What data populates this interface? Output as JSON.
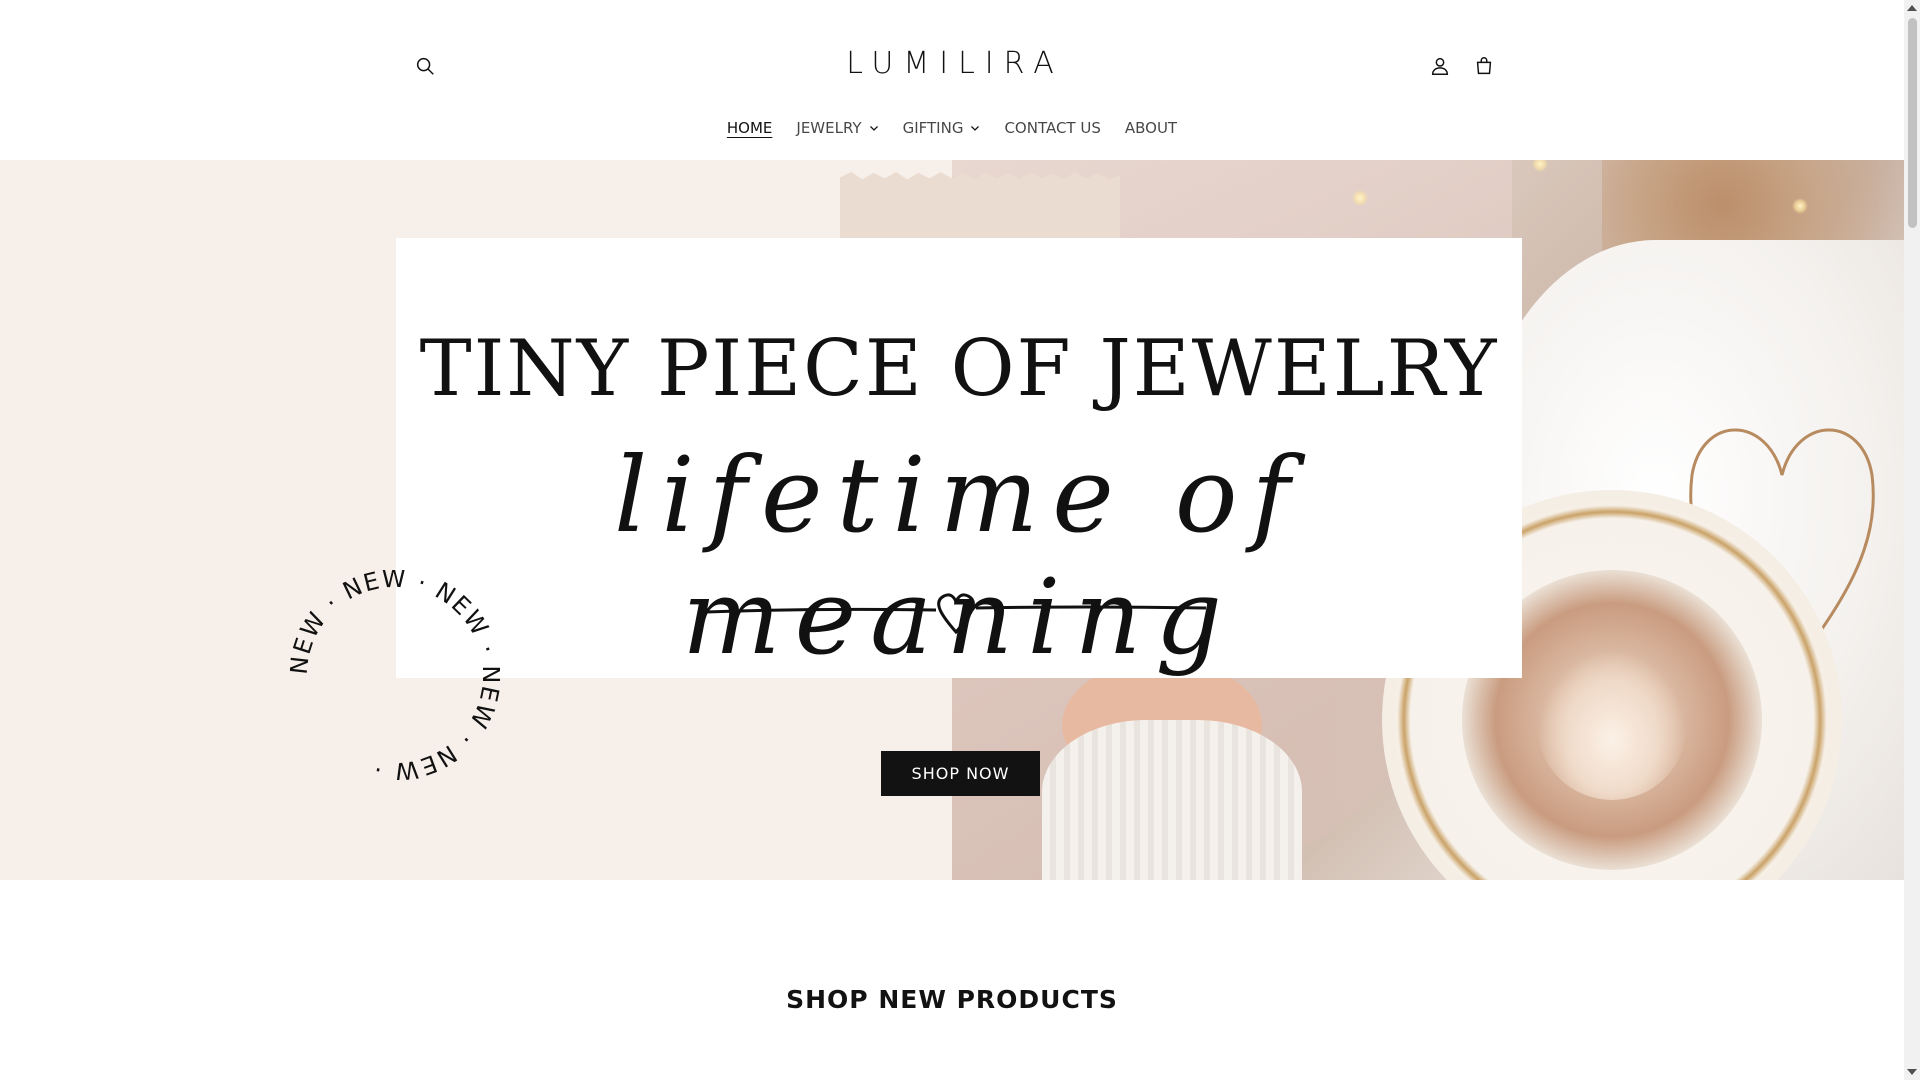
{
  "header": {
    "logo": "LUMILIRA",
    "icons": {
      "search": "search-icon",
      "account": "user-icon",
      "cart": "cart-icon"
    }
  },
  "nav": {
    "items": [
      {
        "label": "HOME",
        "active": true,
        "dropdown": false
      },
      {
        "label": "JEWELRY",
        "active": false,
        "dropdown": true
      },
      {
        "label": "GIFTING",
        "active": false,
        "dropdown": true
      },
      {
        "label": "CONTACT US",
        "active": false,
        "dropdown": false
      },
      {
        "label": "ABOUT",
        "active": false,
        "dropdown": false
      }
    ]
  },
  "hero": {
    "headline": "TINY PIECE OF JEWELRY",
    "script": "lifetime of meaning",
    "badge_text": "NEW · NEW · NEW · NEW · NEW · ",
    "cta": "SHOP NOW"
  },
  "sections": {
    "new_products_title": "SHOP NEW PRODUCTS"
  },
  "colors": {
    "accent": "#121212",
    "hero_bg": "#f7efea",
    "card_bg": "#ffffff",
    "tape": "#eadcd0"
  }
}
